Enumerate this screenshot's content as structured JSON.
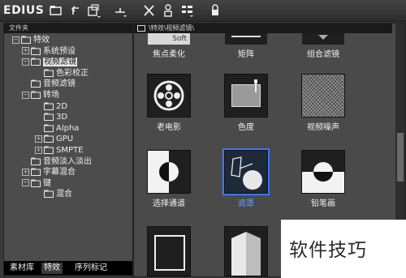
{
  "app": {
    "title": "EDIUS"
  },
  "toolbar": {
    "icons": [
      "folder-icon",
      "up-icon",
      "clip-icon",
      "import-icon",
      "delete-icon",
      "properties-icon",
      "view-icon",
      "lock-icon"
    ]
  },
  "left_panel": {
    "header": "文件夹",
    "tree": [
      {
        "label": "特效",
        "level": 0,
        "expander": "−"
      },
      {
        "label": "系统预设",
        "level": 1,
        "expander": "+"
      },
      {
        "label": "视频滤镜",
        "level": 1,
        "expander": "−",
        "selected": true
      },
      {
        "label": "色彩校正",
        "level": 2,
        "expander": ""
      },
      {
        "label": "音频滤镜",
        "level": 1,
        "expander": ""
      },
      {
        "label": "转场",
        "level": 1,
        "expander": "−"
      },
      {
        "label": "2D",
        "level": 2,
        "expander": ""
      },
      {
        "label": "3D",
        "level": 2,
        "expander": ""
      },
      {
        "label": "Alpha",
        "level": 2,
        "expander": ""
      },
      {
        "label": "GPU",
        "level": 2,
        "expander": "+"
      },
      {
        "label": "SMPTE",
        "level": 2,
        "expander": "+"
      },
      {
        "label": "音频淡入淡出",
        "level": 1,
        "expander": ""
      },
      {
        "label": "字幕混合",
        "level": 1,
        "expander": "+"
      },
      {
        "label": "键",
        "level": 1,
        "expander": "−"
      },
      {
        "label": "混合",
        "level": 2,
        "expander": ""
      }
    ],
    "tabs": [
      "素材库",
      "特效",
      "序列标记"
    ],
    "active_tab": "特效"
  },
  "right_panel": {
    "path": "\\特效\\视频滤镜\\",
    "top_thumb_text": "Soft",
    "effects": [
      {
        "label": "焦点柔化"
      },
      {
        "label": "矩阵"
      },
      {
        "label": "组合滤镜"
      },
      {
        "label": "老电影"
      },
      {
        "label": "色度"
      },
      {
        "label": "视频噪声"
      },
      {
        "label": "选择通道"
      },
      {
        "label": "遮罩",
        "selected": true
      },
      {
        "label": "铅笔画"
      }
    ]
  },
  "watermark": {
    "text": "软件技巧"
  }
}
